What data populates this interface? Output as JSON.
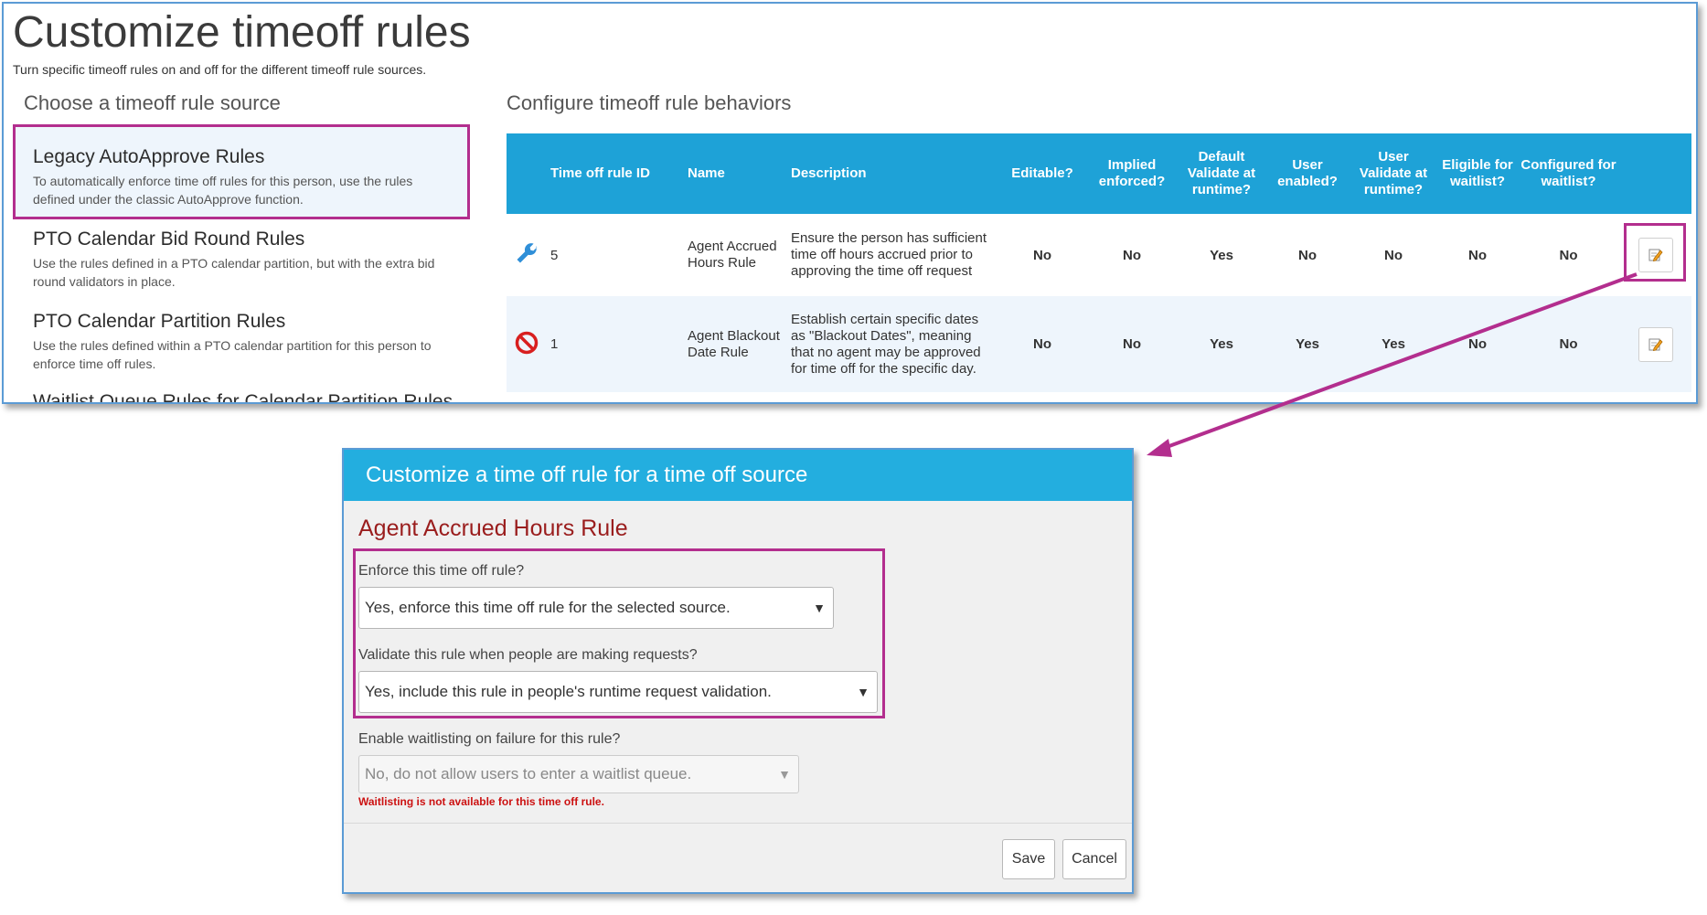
{
  "page": {
    "title": "Customize timeoff rules",
    "subtitle": "Turn specific timeoff rules on and off for the different timeoff rule sources."
  },
  "sources": {
    "heading": "Choose a timeoff rule source",
    "items": [
      {
        "title": "Legacy AutoApprove Rules",
        "desc": "To automatically enforce time off rules for this person, use the rules defined under the classic AutoApprove function."
      },
      {
        "title": "PTO Calendar Bid Round Rules",
        "desc": "Use the rules defined in a PTO calendar partition, but with the extra bid round validators in place."
      },
      {
        "title": "PTO Calendar Partition Rules",
        "desc": "Use the rules defined within a PTO calendar partition for this person to enforce time off rules."
      },
      {
        "title": "Waitlist Queue Rules for Calendar Partition Rules",
        "desc": ""
      }
    ]
  },
  "config": {
    "heading": "Configure timeoff rule behaviors",
    "columns": [
      "Time off rule ID",
      "Name",
      "Description",
      "Editable?",
      "Implied enforced?",
      "Default Validate at runtime?",
      "User enabled?",
      "User Validate at runtime?",
      "Eligible for waitlist?",
      "Configured for waitlist?"
    ],
    "rows": [
      {
        "icon": "wrench-icon",
        "id": "5",
        "name": "Agent Accrued Hours Rule",
        "description": "Ensure the person has sufficient time off hours accrued prior to approving the time off request",
        "editable": "No",
        "implied": "No",
        "default_validate": "Yes",
        "user_enabled": "No",
        "user_validate": "No",
        "eligible": "No",
        "configured": "No"
      },
      {
        "icon": "prohibited-icon",
        "id": "1",
        "name": "Agent Blackout Date Rule",
        "description": "Establish certain specific dates as \"Blackout Dates\", meaning that no agent may be approved for time off for the specific day.",
        "editable": "No",
        "implied": "No",
        "default_validate": "Yes",
        "user_enabled": "Yes",
        "user_validate": "Yes",
        "eligible": "No",
        "configured": "No"
      }
    ]
  },
  "dialog": {
    "title": "Customize a time off rule for a time off source",
    "rule_name": "Agent Accrued Hours Rule",
    "enforce_label": "Enforce this time off rule?",
    "enforce_value": "Yes, enforce this time off rule for the selected source.",
    "validate_label": "Validate this rule when people are making requests?",
    "validate_value": "Yes, include this rule in people's runtime request validation.",
    "waitlist_label": "Enable waitlisting on failure for this rule?",
    "waitlist_value": "No, do not allow users to enter a waitlist queue.",
    "waitlist_note": "Waitlisting is not available for this time off rule.",
    "save_label": "Save",
    "cancel_label": "Cancel"
  },
  "colors": {
    "accent": "#1ea2d7",
    "highlight": "#b32e8e",
    "no": "#cc1111",
    "yes": "#6a9a0a",
    "rule_name": "#9a1d1d"
  }
}
